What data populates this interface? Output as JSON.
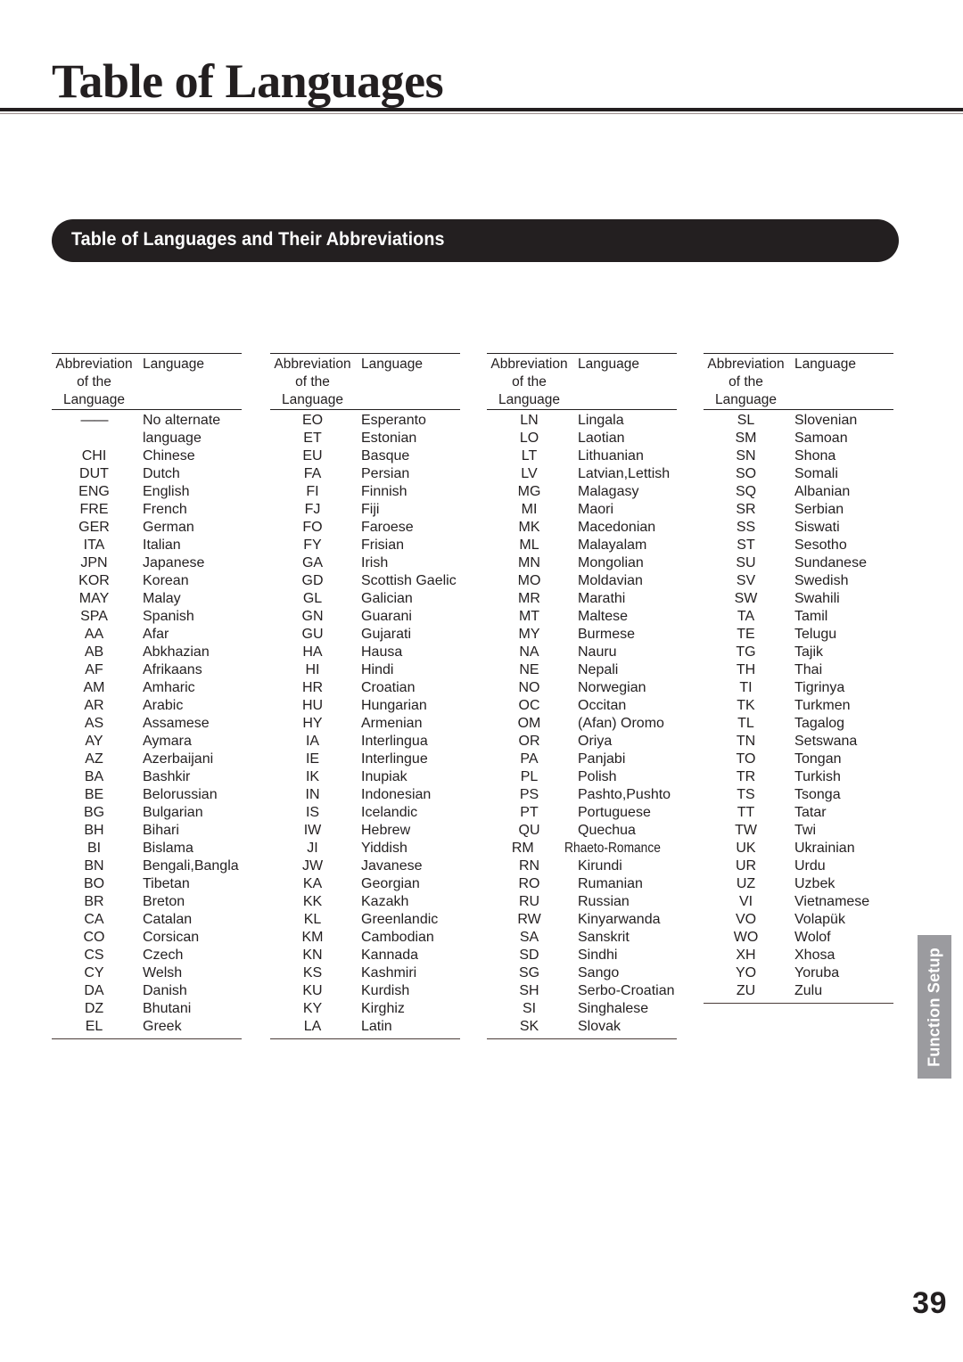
{
  "page": {
    "title": "Table of Languages",
    "number": "39"
  },
  "section": {
    "banner_label": "Table of Languages and Their Abbreviations"
  },
  "side_tab": {
    "label": "Function Setup"
  },
  "table": {
    "header": {
      "abbr_line1": "Abbreviation",
      "abbr_line2": "of the",
      "abbr_line3": "Language",
      "language": "Language"
    },
    "columns": [
      {
        "rows": [
          {
            "abbr": "——",
            "name": "No alternate"
          },
          {
            "abbr": "",
            "name": "language"
          },
          {
            "abbr": "CHI",
            "name": "Chinese"
          },
          {
            "abbr": "DUT",
            "name": "Dutch"
          },
          {
            "abbr": "ENG",
            "name": "English"
          },
          {
            "abbr": "FRE",
            "name": "French"
          },
          {
            "abbr": "GER",
            "name": "German"
          },
          {
            "abbr": "ITA",
            "name": "Italian"
          },
          {
            "abbr": "JPN",
            "name": "Japanese"
          },
          {
            "abbr": "KOR",
            "name": "Korean"
          },
          {
            "abbr": "MAY",
            "name": "Malay"
          },
          {
            "abbr": "SPA",
            "name": "Spanish"
          },
          {
            "abbr": "AA",
            "name": "Afar"
          },
          {
            "abbr": "AB",
            "name": "Abkhazian"
          },
          {
            "abbr": "AF",
            "name": "Afrikaans"
          },
          {
            "abbr": "AM",
            "name": "Amharic"
          },
          {
            "abbr": "AR",
            "name": "Arabic"
          },
          {
            "abbr": "AS",
            "name": "Assamese"
          },
          {
            "abbr": "AY",
            "name": "Aymara"
          },
          {
            "abbr": "AZ",
            "name": "Azerbaijani"
          },
          {
            "abbr": "BA",
            "name": "Bashkir"
          },
          {
            "abbr": "BE",
            "name": "Belorussian"
          },
          {
            "abbr": "BG",
            "name": "Bulgarian"
          },
          {
            "abbr": "BH",
            "name": "Bihari"
          },
          {
            "abbr": "BI",
            "name": "Bislama"
          },
          {
            "abbr": "BN",
            "name": "Bengali,Bangla"
          },
          {
            "abbr": "BO",
            "name": "Tibetan"
          },
          {
            "abbr": "BR",
            "name": "Breton"
          },
          {
            "abbr": "CA",
            "name": "Catalan"
          },
          {
            "abbr": "CO",
            "name": "Corsican"
          },
          {
            "abbr": "CS",
            "name": "Czech"
          },
          {
            "abbr": "CY",
            "name": "Welsh"
          },
          {
            "abbr": "DA",
            "name": "Danish"
          },
          {
            "abbr": "DZ",
            "name": "Bhutani"
          },
          {
            "abbr": "EL",
            "name": "Greek"
          }
        ]
      },
      {
        "rows": [
          {
            "abbr": "EO",
            "name": "Esperanto"
          },
          {
            "abbr": "ET",
            "name": "Estonian"
          },
          {
            "abbr": "EU",
            "name": "Basque"
          },
          {
            "abbr": "FA",
            "name": "Persian"
          },
          {
            "abbr": "FI",
            "name": "Finnish"
          },
          {
            "abbr": "FJ",
            "name": "Fiji"
          },
          {
            "abbr": "FO",
            "name": "Faroese"
          },
          {
            "abbr": "FY",
            "name": "Frisian"
          },
          {
            "abbr": "GA",
            "name": "Irish"
          },
          {
            "abbr": "GD",
            "name": "Scottish Gaelic"
          },
          {
            "abbr": "GL",
            "name": "Galician"
          },
          {
            "abbr": "GN",
            "name": "Guarani"
          },
          {
            "abbr": "GU",
            "name": "Gujarati"
          },
          {
            "abbr": "HA",
            "name": "Hausa"
          },
          {
            "abbr": "HI",
            "name": "Hindi"
          },
          {
            "abbr": "HR",
            "name": "Croatian"
          },
          {
            "abbr": "HU",
            "name": "Hungarian"
          },
          {
            "abbr": "HY",
            "name": "Armenian"
          },
          {
            "abbr": "IA",
            "name": "Interlingua"
          },
          {
            "abbr": "IE",
            "name": "Interlingue"
          },
          {
            "abbr": "IK",
            "name": "Inupiak"
          },
          {
            "abbr": "IN",
            "name": "Indonesian"
          },
          {
            "abbr": "IS",
            "name": "Icelandic"
          },
          {
            "abbr": "IW",
            "name": "Hebrew"
          },
          {
            "abbr": "JI",
            "name": "Yiddish"
          },
          {
            "abbr": "JW",
            "name": "Javanese"
          },
          {
            "abbr": "KA",
            "name": "Georgian"
          },
          {
            "abbr": "KK",
            "name": "Kazakh"
          },
          {
            "abbr": "KL",
            "name": "Greenlandic"
          },
          {
            "abbr": "KM",
            "name": "Cambodian"
          },
          {
            "abbr": "KN",
            "name": "Kannada"
          },
          {
            "abbr": "KS",
            "name": "Kashmiri"
          },
          {
            "abbr": "KU",
            "name": "Kurdish"
          },
          {
            "abbr": "KY",
            "name": "Kirghiz"
          },
          {
            "abbr": "LA",
            "name": "Latin"
          }
        ]
      },
      {
        "rows": [
          {
            "abbr": "LN",
            "name": "Lingala"
          },
          {
            "abbr": "LO",
            "name": "Laotian"
          },
          {
            "abbr": "LT",
            "name": "Lithuanian"
          },
          {
            "abbr": "LV",
            "name": "Latvian,Lettish"
          },
          {
            "abbr": "MG",
            "name": "Malagasy"
          },
          {
            "abbr": "MI",
            "name": "Maori"
          },
          {
            "abbr": "MK",
            "name": "Macedonian"
          },
          {
            "abbr": "ML",
            "name": "Malayalam"
          },
          {
            "abbr": "MN",
            "name": "Mongolian"
          },
          {
            "abbr": "MO",
            "name": "Moldavian"
          },
          {
            "abbr": "MR",
            "name": "Marathi"
          },
          {
            "abbr": "MT",
            "name": "Maltese"
          },
          {
            "abbr": "MY",
            "name": "Burmese"
          },
          {
            "abbr": "NA",
            "name": "Nauru"
          },
          {
            "abbr": "NE",
            "name": "Nepali"
          },
          {
            "abbr": "NO",
            "name": "Norwegian"
          },
          {
            "abbr": "OC",
            "name": "Occitan"
          },
          {
            "abbr": "OM",
            "name": "(Afan) Oromo"
          },
          {
            "abbr": "OR",
            "name": "Oriya"
          },
          {
            "abbr": "PA",
            "name": "Panjabi"
          },
          {
            "abbr": "PL",
            "name": "Polish"
          },
          {
            "abbr": "PS",
            "name": "Pashto,Pushto"
          },
          {
            "abbr": "PT",
            "name": "Portuguese"
          },
          {
            "abbr": "QU",
            "name": "Quechua"
          },
          {
            "abbr": "RM",
            "name": "Rhaeto-Romance",
            "squeeze": true
          },
          {
            "abbr": "RN",
            "name": "Kirundi"
          },
          {
            "abbr": "RO",
            "name": "Rumanian"
          },
          {
            "abbr": "RU",
            "name": "Russian"
          },
          {
            "abbr": "RW",
            "name": "Kinyarwanda"
          },
          {
            "abbr": "SA",
            "name": "Sanskrit"
          },
          {
            "abbr": "SD",
            "name": "Sindhi"
          },
          {
            "abbr": "SG",
            "name": "Sango"
          },
          {
            "abbr": "SH",
            "name": "Serbo-Croatian"
          },
          {
            "abbr": "SI",
            "name": "Singhalese"
          },
          {
            "abbr": "SK",
            "name": "Slovak"
          }
        ]
      },
      {
        "rows": [
          {
            "abbr": "SL",
            "name": "Slovenian"
          },
          {
            "abbr": "SM",
            "name": "Samoan"
          },
          {
            "abbr": "SN",
            "name": "Shona"
          },
          {
            "abbr": "SO",
            "name": "Somali"
          },
          {
            "abbr": "SQ",
            "name": "Albanian"
          },
          {
            "abbr": "SR",
            "name": "Serbian"
          },
          {
            "abbr": "SS",
            "name": "Siswati"
          },
          {
            "abbr": "ST",
            "name": "Sesotho"
          },
          {
            "abbr": "SU",
            "name": "Sundanese"
          },
          {
            "abbr": "SV",
            "name": "Swedish"
          },
          {
            "abbr": "SW",
            "name": "Swahili"
          },
          {
            "abbr": "TA",
            "name": "Tamil"
          },
          {
            "abbr": "TE",
            "name": "Telugu"
          },
          {
            "abbr": "TG",
            "name": "Tajik"
          },
          {
            "abbr": "TH",
            "name": "Thai"
          },
          {
            "abbr": "TI",
            "name": "Tigrinya"
          },
          {
            "abbr": "TK",
            "name": "Turkmen"
          },
          {
            "abbr": "TL",
            "name": "Tagalog"
          },
          {
            "abbr": "TN",
            "name": "Setswana"
          },
          {
            "abbr": "TO",
            "name": "Tongan"
          },
          {
            "abbr": "TR",
            "name": "Turkish"
          },
          {
            "abbr": "TS",
            "name": "Tsonga"
          },
          {
            "abbr": "TT",
            "name": "Tatar"
          },
          {
            "abbr": "TW",
            "name": "Twi"
          },
          {
            "abbr": "UK",
            "name": "Ukrainian"
          },
          {
            "abbr": "UR",
            "name": "Urdu"
          },
          {
            "abbr": "UZ",
            "name": "Uzbek"
          },
          {
            "abbr": "VI",
            "name": "Vietnamese"
          },
          {
            "abbr": "VO",
            "name": "Volapük"
          },
          {
            "abbr": "WO",
            "name": "Wolof"
          },
          {
            "abbr": "XH",
            "name": "Xhosa"
          },
          {
            "abbr": "YO",
            "name": "Yoruba"
          },
          {
            "abbr": "ZU",
            "name": "Zulu"
          }
        ]
      }
    ]
  }
}
